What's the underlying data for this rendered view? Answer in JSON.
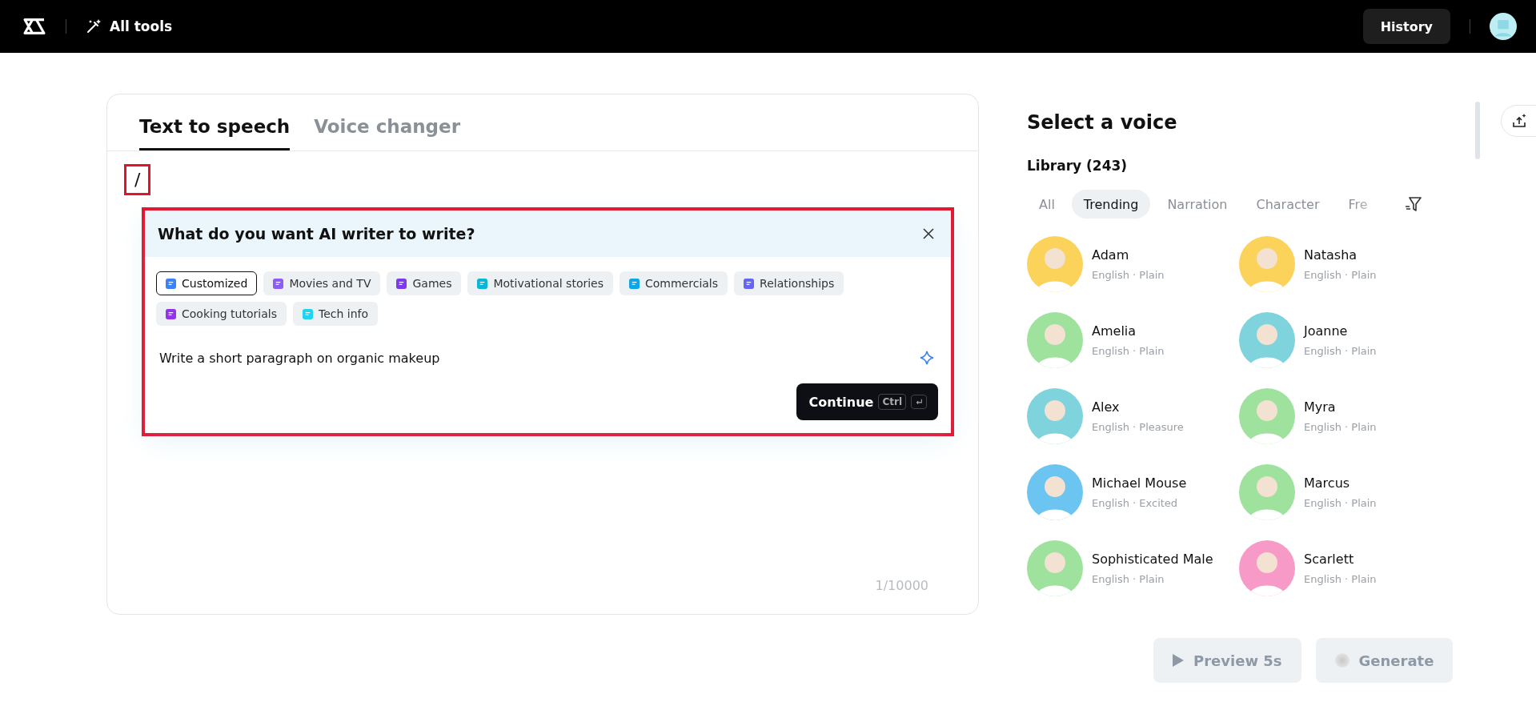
{
  "top_bar": {
    "all_tools": "All tools",
    "history": "History"
  },
  "editor": {
    "tabs": [
      {
        "label": "Text to speech",
        "selected": true
      },
      {
        "label": "Voice changer",
        "selected": false
      }
    ],
    "typed_text": "/",
    "typed_highlighted": true,
    "ai_writer": {
      "highlighted": true,
      "title": "What do you want AI writer to write?",
      "categories": [
        {
          "label": "Customized",
          "selected": true,
          "color": "#3b82f6"
        },
        {
          "label": "Movies and TV",
          "selected": false,
          "color": "#8b5cf6"
        },
        {
          "label": "Games",
          "selected": false,
          "color": "#7c3aed"
        },
        {
          "label": "Motivational stories",
          "selected": false,
          "color": "#06b6d4"
        },
        {
          "label": "Commercials",
          "selected": false,
          "color": "#0ea5e9"
        },
        {
          "label": "Relationships",
          "selected": false,
          "color": "#6366f1"
        },
        {
          "label": "Cooking tutorials",
          "selected": false,
          "color": "#9333ea"
        },
        {
          "label": "Tech info",
          "selected": false,
          "color": "#22d3ee"
        }
      ],
      "prompt": "Write a short paragraph on organic makeup",
      "continue": "Continue",
      "shortcut": "Ctrl"
    },
    "counter": "1/10000"
  },
  "voices": {
    "title": "Select a voice",
    "library": "Library (243)",
    "filters": [
      {
        "label": "All",
        "selected": false
      },
      {
        "label": "Trending",
        "selected": true
      },
      {
        "label": "Narration",
        "selected": false
      },
      {
        "label": "Character",
        "selected": false
      },
      {
        "label": "Fre",
        "selected": false
      }
    ],
    "items": [
      {
        "name": "Adam",
        "style": "English · Plain",
        "color": "#fbd25a"
      },
      {
        "name": "Natasha",
        "style": "English · Plain",
        "color": "#fbd25a"
      },
      {
        "name": "Amelia",
        "style": "English · Plain",
        "color": "#9ee29e"
      },
      {
        "name": "Joanne",
        "style": "English · Plain",
        "color": "#7fd3dc"
      },
      {
        "name": "Alex",
        "style": "English · Pleasure",
        "color": "#7fd3dc"
      },
      {
        "name": "Myra",
        "style": "English · Plain",
        "color": "#9ee29e"
      },
      {
        "name": "Michael Mouse",
        "style": "English · Excited",
        "color": "#6cc4f0"
      },
      {
        "name": "Marcus",
        "style": "English · Plain",
        "color": "#9ee29e"
      },
      {
        "name": "Sophisticated Male",
        "style": "English · Plain",
        "color": "#9ee29e"
      },
      {
        "name": "Scarlett",
        "style": "English · Plain",
        "color": "#f79ac8"
      }
    ]
  },
  "actions": [
    {
      "kind": "preview",
      "label": "Preview 5s",
      "disabled": true
    },
    {
      "kind": "generate",
      "label": "Generate",
      "disabled": true
    }
  ]
}
